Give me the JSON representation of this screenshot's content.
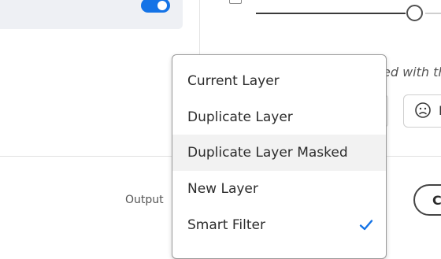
{
  "settings": {
    "toggle_on": true,
    "accent": "#1473e6",
    "italic_fragment": "ed with th",
    "feedback_letter": "I",
    "output_label": "Output",
    "button_fragment": "C"
  },
  "menu": {
    "items": [
      {
        "label": "Current Layer"
      },
      {
        "label": "Duplicate Layer"
      },
      {
        "label": "Duplicate Layer Masked"
      },
      {
        "label": "New Layer"
      },
      {
        "label": "Smart Filter"
      }
    ],
    "highlighted": "Duplicate Layer Masked",
    "selected": "Smart Filter"
  },
  "icons": {
    "feedback": "frown-face-icon",
    "selected_mark": "checkmark-icon"
  }
}
